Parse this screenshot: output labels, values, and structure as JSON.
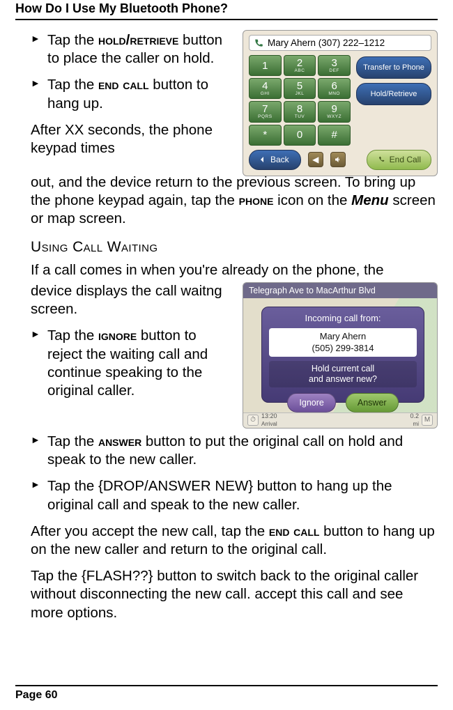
{
  "header": "How Do I Use My Bluetooth Phone?",
  "footer": "Page 60",
  "bullets1": {
    "a_pre": "Tap the ",
    "a_kw": "hold/retrieve",
    "a_post": " button to place the caller on hold.",
    "b_pre": "Tap the ",
    "b_kw": "end call",
    "b_post": " button to hang up."
  },
  "para_timeout": {
    "t1": "After XX seconds, the phone keypad times out, and the device return to the previous screen. To bring up the phone keypad again, tap the ",
    "kw": "phone",
    "t2": " icon on the ",
    "ital": "Menu",
    "t3": " screen or map screen."
  },
  "heading_cw": "Using Call Waiting",
  "para_cw_intro": {
    "t1": "If a call comes in when you're already on the phone, the device displays the call waitng screen."
  },
  "bullets2": {
    "a_pre": "Tap the ",
    "a_kw": "ignore",
    "a_post": " button to reject the waiting call and continue speaking to the original caller.",
    "b_pre": "Tap the ",
    "b_kw": "answer",
    "b_post": " button to put the original call on hold and speak to the new caller.",
    "c": "Tap the {DROP/ANSWER NEW} button to hang up the original call and speak to the new caller."
  },
  "para_after": {
    "t1": "After you accept the new call, tap the ",
    "kw": "end call",
    "t2": " button to hang up on the new caller and return to the original call."
  },
  "para_flash": "Tap the {FLASH??} button to switch back to the original caller without disconnecting the new call. accept this call and see more options.",
  "fig1": {
    "caller": "Mary Ahern (307) 222–1212",
    "keys": [
      {
        "n": "1",
        "l": ""
      },
      {
        "n": "2",
        "l": "ABC"
      },
      {
        "n": "3",
        "l": "DEF"
      },
      {
        "n": "4",
        "l": "GHI"
      },
      {
        "n": "5",
        "l": "JKL"
      },
      {
        "n": "6",
        "l": "MNO"
      },
      {
        "n": "7",
        "l": "PQRS"
      },
      {
        "n": "8",
        "l": "TUV"
      },
      {
        "n": "9",
        "l": "WXYZ"
      },
      {
        "n": "*",
        "l": ""
      },
      {
        "n": "0",
        "l": ""
      },
      {
        "n": "#",
        "l": ""
      }
    ],
    "transfer": "Transfer to Phone",
    "hold": "Hold/Retrieve",
    "back": "Back",
    "end": "End Call"
  },
  "fig2": {
    "topbar": "Telegraph Ave to MacArthur Blvd",
    "incoming": "Incoming call from:",
    "caller_name": "Mary Ahern",
    "caller_num": "(505) 299-3814",
    "prompt_l1": "Hold current call",
    "prompt_l2": "and answer new?",
    "ignore": "Ignore",
    "answer": "Answer",
    "bl_time": "13:20",
    "bl_lbl": "Arrival",
    "br_dist": "0.2",
    "br_lbl": "mi"
  }
}
